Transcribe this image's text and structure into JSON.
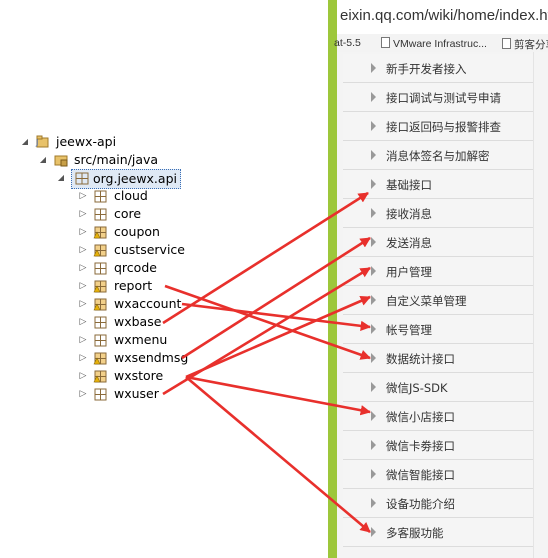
{
  "tree": {
    "project": "jeewx-api",
    "source_folder": "src/main/java",
    "package": "org.jeewx.api",
    "children": [
      "cloud",
      "core",
      "coupon",
      "custservice",
      "qrcode",
      "report",
      "wxaccount",
      "wxbase",
      "wxmenu",
      "wxsendmsg",
      "wxstore",
      "wxuser"
    ]
  },
  "browser": {
    "url": "eixin.qq.com/wiki/home/index.htm",
    "bookmarks": [
      "at-5.5",
      "VMware Infrastruc...",
      "剪客分享"
    ]
  },
  "menu": {
    "items": [
      "新手开发者接入",
      "接口调试与测试号申请",
      "接口返回码与报警排查",
      "消息体签名与加解密",
      "基础接口",
      "接收消息",
      "发送消息",
      "用户管理",
      "自定义菜单管理",
      "帐号管理",
      "数据统计接口",
      "微信JS-SDK",
      "微信小店接口",
      "微信卡劵接口",
      "微信智能接口",
      "设备功能介绍",
      "多客服功能"
    ]
  },
  "colors": {
    "arrow": "#e8302c",
    "browser_edge": "#9dc73b",
    "menu_bg": "#f5f5f5"
  },
  "icons": [
    "collapse-triangle-icon",
    "expand-triangle-icon",
    "project-icon",
    "source-folder-icon",
    "package-icon",
    "page-icon",
    "menu-arrow-icon"
  ]
}
